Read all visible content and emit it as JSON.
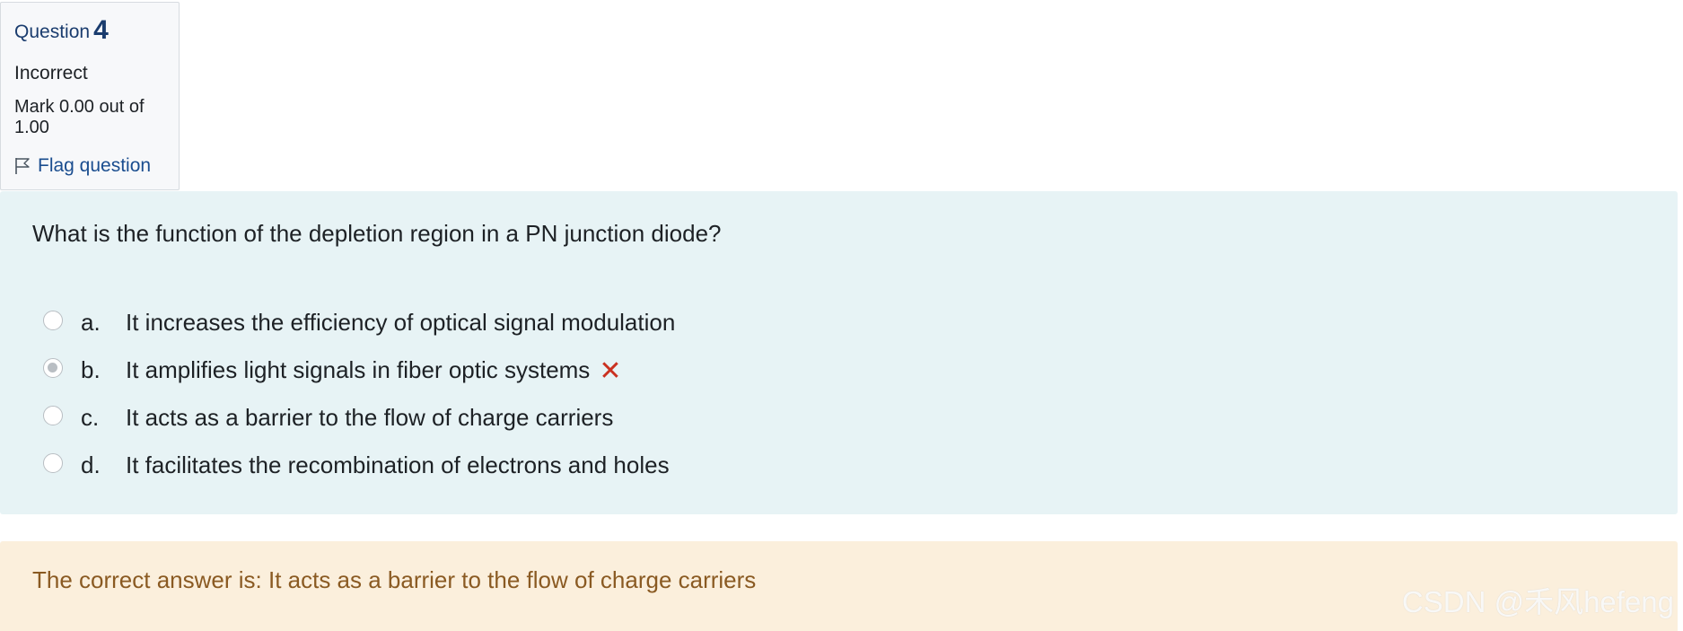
{
  "info": {
    "question_label": "Question",
    "question_number": "4",
    "state": "Incorrect",
    "grade_line1": "Mark 0.00 out of",
    "grade_line2": "1.00",
    "flag_label": "Flag question"
  },
  "question": {
    "text": "What is the function of the depletion region in a PN junction diode?",
    "answers": [
      {
        "letter": "a.",
        "text": "It increases the efficiency of optical signal modulation",
        "selected": false
      },
      {
        "letter": "b.",
        "text": "It amplifies light signals in fiber optic systems",
        "selected": true,
        "mark_icon": "incorrect-cross-icon"
      },
      {
        "letter": "c.",
        "text": "It acts as a barrier to the flow of charge carriers",
        "selected": false
      },
      {
        "letter": "d.",
        "text": "It facilitates the recombination of electrons and holes",
        "selected": false
      }
    ]
  },
  "feedback": {
    "right_answer": "The correct answer is: It acts as a barrier to the flow of charge carriers"
  },
  "watermark": "CSDN @禾风hefeng",
  "colors": {
    "formulation_bg": "#e7f3f5",
    "outcome_bg": "#fbefdc",
    "outcome_text": "#8a5a22",
    "incorrect": "#ca3120",
    "link": "#1a4d8f"
  }
}
